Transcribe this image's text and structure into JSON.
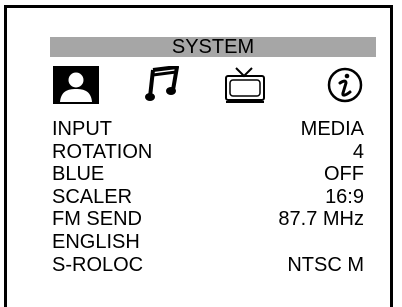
{
  "osd": {
    "title": "SYSTEM",
    "title_bar_color": "#a6a6a6",
    "tabs": [
      {
        "icon": "user-icon",
        "selected": true
      },
      {
        "icon": "music-note-icon",
        "selected": false
      },
      {
        "icon": "tv-icon",
        "selected": false
      },
      {
        "icon": "info-icon",
        "selected": false
      }
    ],
    "items": [
      {
        "label": "INPUT",
        "value": "MEDIA"
      },
      {
        "label": "ROTATION",
        "value": "4"
      },
      {
        "label": "BLUE",
        "value": "OFF"
      },
      {
        "label": "SCALER",
        "value": "16:9"
      },
      {
        "label": "FM SEND",
        "value": "87.7 MHz"
      },
      {
        "label": "ENGLISH",
        "value": ""
      },
      {
        "label": "S-ROLOC",
        "value": "NTSC M"
      }
    ]
  }
}
